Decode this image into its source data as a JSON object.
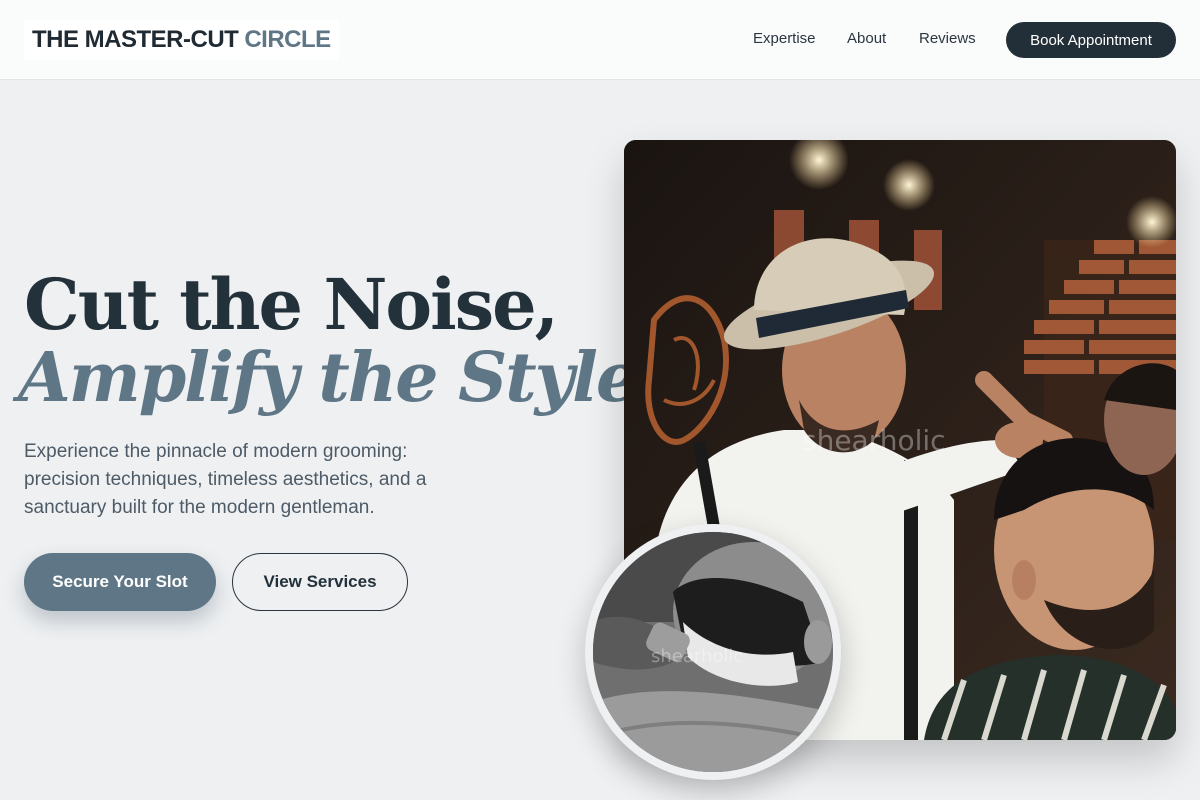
{
  "header": {
    "logo_part1": "THE MASTER-CUT",
    "logo_part2": "CIRCLE",
    "nav": {
      "expertise": "Expertise",
      "about": "About",
      "reviews": "Reviews"
    },
    "cta": "Book Appointment"
  },
  "hero": {
    "headline_line1": "Cut the Noise,",
    "headline_line2": "Amplify the Style.",
    "subtext": "Experience the pinnacle of modern grooming: precision techniques, timeless aesthetics, and a sanctuary built for the modern gentleman.",
    "primary_button": "Secure Your Slot",
    "secondary_button": "View Services",
    "main_image_watermark": "shearholic",
    "inset_image_watermark": "shearholic"
  },
  "colors": {
    "accent": "#5e7686",
    "dark": "#23313b",
    "background": "#eef0f2"
  }
}
